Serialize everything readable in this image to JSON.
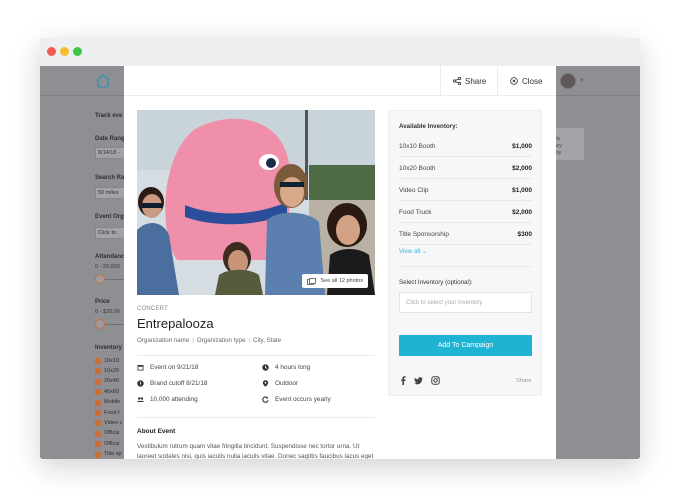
{
  "window": {
    "colors": {
      "close": "#f45a52",
      "minimize": "#f6be2f",
      "maximize": "#3ec64a"
    }
  },
  "background_app": {
    "sidebar": {
      "track_label": "Track eve",
      "date_range_label": "Date Rang",
      "date_value": "8/14/18 -",
      "search_radius_label": "Search Ra",
      "search_value": "50 miles",
      "event_org_label": "Event Orga",
      "event_org_placeholder": "Click to",
      "attendance_label": "Attendanc",
      "attendance_range": "0 - 20,000",
      "price_label": "Price",
      "price_range": "0 - $20,00",
      "inventory_label": "Inventory",
      "inventory_items": [
        "10x10",
        "10x20",
        "20x40",
        "40x60",
        "Mobile",
        "Food t",
        "Video c",
        "Officia",
        "Officia",
        "Title sp"
      ]
    },
    "card_text": [
      "lity",
      "acy",
      "ility"
    ]
  },
  "modal": {
    "header": {
      "share_label": "Share",
      "close_label": "Close"
    },
    "hero": {
      "photo_badge": "See all 12 photos"
    },
    "event": {
      "category": "CONCERT",
      "title": "Entrepalooza",
      "organization_name": "Organization name",
      "organization_type": "Organization type",
      "location": "City, State",
      "facts": {
        "event_date": "Event on 9/21/18",
        "duration": "4 hours long",
        "brand_cutoff": "Brand cutoff 8/21/18",
        "setting": "Outdoor",
        "attendance": "10,000 attending",
        "recurrence": "Event occurs yearly"
      },
      "about_heading": "About Event",
      "about_text": "Vestibulum rutrum quam vitae fringilla tincidunt. Suspendisse nec tortor urna. Ut laoreet sodales nisi, quis iaculis nulla iaculis vitae. Donec sagittis faucibus lacus eget"
    },
    "inventory": {
      "heading": "Available Inventory:",
      "items": [
        {
          "name": "10x10 Booth",
          "price": "$1,000"
        },
        {
          "name": "10x20 Booth",
          "price": "$2,000"
        },
        {
          "name": "Video Clip",
          "price": "$1,000"
        },
        {
          "name": "Food Truck",
          "price": "$2,000"
        },
        {
          "name": "Title Sponsorship",
          "price": "$300"
        }
      ],
      "view_all": "View all",
      "select_label": "Select Inventory (optional):",
      "select_placeholder": "Click to select your inventory",
      "add_button": "Add To Campaign",
      "share_label": "Share"
    }
  },
  "colors": {
    "accent": "#1fb3d3",
    "link": "#3bb4d6"
  }
}
